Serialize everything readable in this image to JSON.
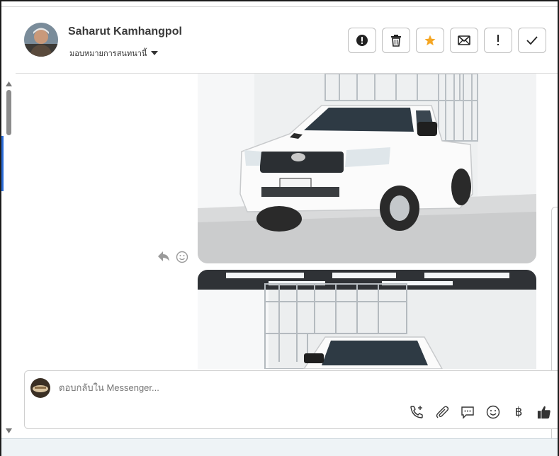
{
  "header": {
    "contact_name": "Saharut Kamhangpol",
    "assign_label": "มอบหมายการสนทนานี้",
    "actions": [
      {
        "name": "spam-button",
        "icon": "exclamation-circle-icon"
      },
      {
        "name": "delete-button",
        "icon": "trash-icon"
      },
      {
        "name": "star-button",
        "icon": "star-icon",
        "color": "#f5a623"
      },
      {
        "name": "mark-unread-button",
        "icon": "envelope-icon"
      },
      {
        "name": "follow-up-button",
        "icon": "exclamation-icon"
      },
      {
        "name": "mark-done-button",
        "icon": "checkmark-icon"
      }
    ]
  },
  "conversation": {
    "messages": [
      {
        "type": "image",
        "alt": "white pickup truck with cargo rack"
      },
      {
        "type": "image",
        "alt": "pickup truck with cargo rack under fluorescent lights"
      }
    ]
  },
  "composer": {
    "placeholder": "ตอบกลับใน Messenger...",
    "baht_symbol": "฿"
  },
  "colors": {
    "accent_blue": "#2b6cd8",
    "star": "#f5a623",
    "text": "#3a3a3a"
  }
}
